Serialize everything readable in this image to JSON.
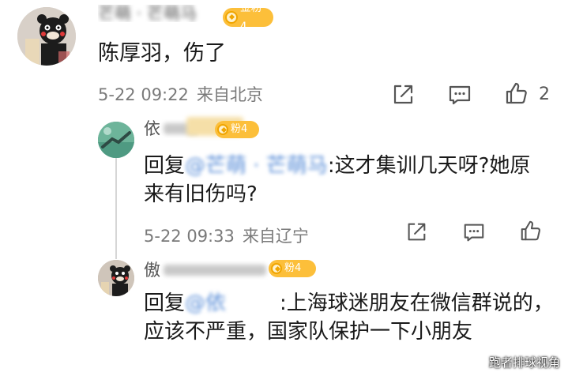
{
  "comment": {
    "author": "芒萌 · 芒萌马",
    "badge": "金粉4",
    "text": "陈厚羽，伤了",
    "time": "5-22 09:22",
    "location": "来自北京",
    "likes": "2",
    "avatar_icon": "cartoon-bear-avatar"
  },
  "replies": [
    {
      "author": "依",
      "badge": "粉4",
      "reply_prefix": "回复",
      "mention": "@芒萌 · 芒萌马",
      "text": ":这才集训几天呀?她原来有旧伤吗?",
      "time": "5-22 09:33",
      "location": "来自辽宁",
      "avatar_icon": "green-landscape-avatar"
    },
    {
      "author": "傲",
      "badge": "粉4",
      "reply_prefix": "回复",
      "mention": "@依",
      "text": ":上海球迷朋友在微信群说的，应该不严重，国家队保护一下小朋友",
      "avatar_icon": "cartoon-bear-avatar"
    }
  ],
  "icons": {
    "share": "share-icon",
    "comment": "comment-icon",
    "like": "like-icon"
  },
  "colors": {
    "badge": "#fcbf3a",
    "meta_text": "#7a7a7a",
    "mention": "#5a8ed8"
  },
  "watermark": "跑者排球视角"
}
